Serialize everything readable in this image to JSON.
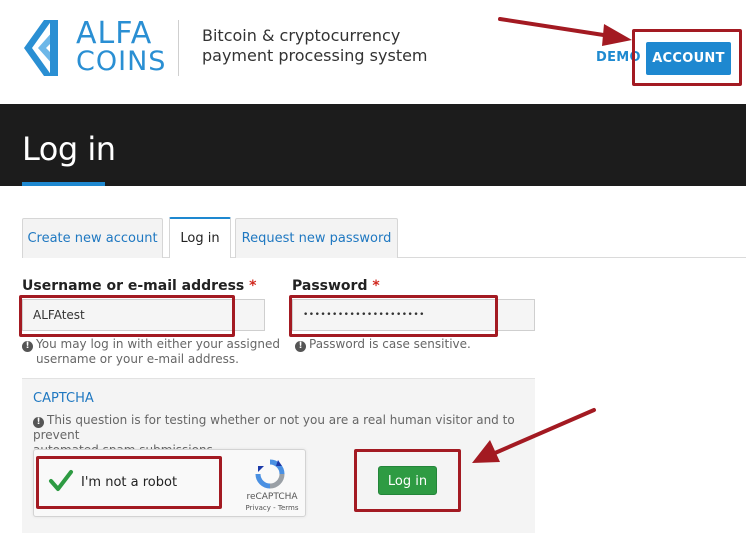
{
  "header": {
    "logo_line1": "ALFA",
    "logo_line2": "COINS",
    "tagline_line1": "Bitcoin & cryptocurrency",
    "tagline_line2": "payment processing system",
    "demo_label": "DEMO",
    "account_label": "ACCOUNT",
    "brand_color": "#1e88d0"
  },
  "page": {
    "title": "Log in"
  },
  "tabs": [
    {
      "label": "Create new account",
      "active": false
    },
    {
      "label": "Log in",
      "active": true
    },
    {
      "label": "Request new password",
      "active": false
    }
  ],
  "form": {
    "username": {
      "label": "Username or e-mail address",
      "required_mark": "*",
      "value": "ALFAtest",
      "description_line1": "You may log in with either your assigned",
      "description_line2": "username or your e-mail address."
    },
    "password": {
      "label": "Password",
      "required_mark": "*",
      "value": "•••••••••••••••••••••",
      "description": "Password is case sensitive."
    },
    "captcha": {
      "title": "CAPTCHA",
      "description_line1": "This question is for testing whether or not you are a real human visitor and to prevent",
      "description_line2": "automated spam submissions.",
      "checkbox_label": "I'm not a robot",
      "brand": "reCAPTCHA",
      "links": "Privacy - Terms"
    },
    "submit_label": "Log in"
  },
  "annotation_color": "#a31a22"
}
